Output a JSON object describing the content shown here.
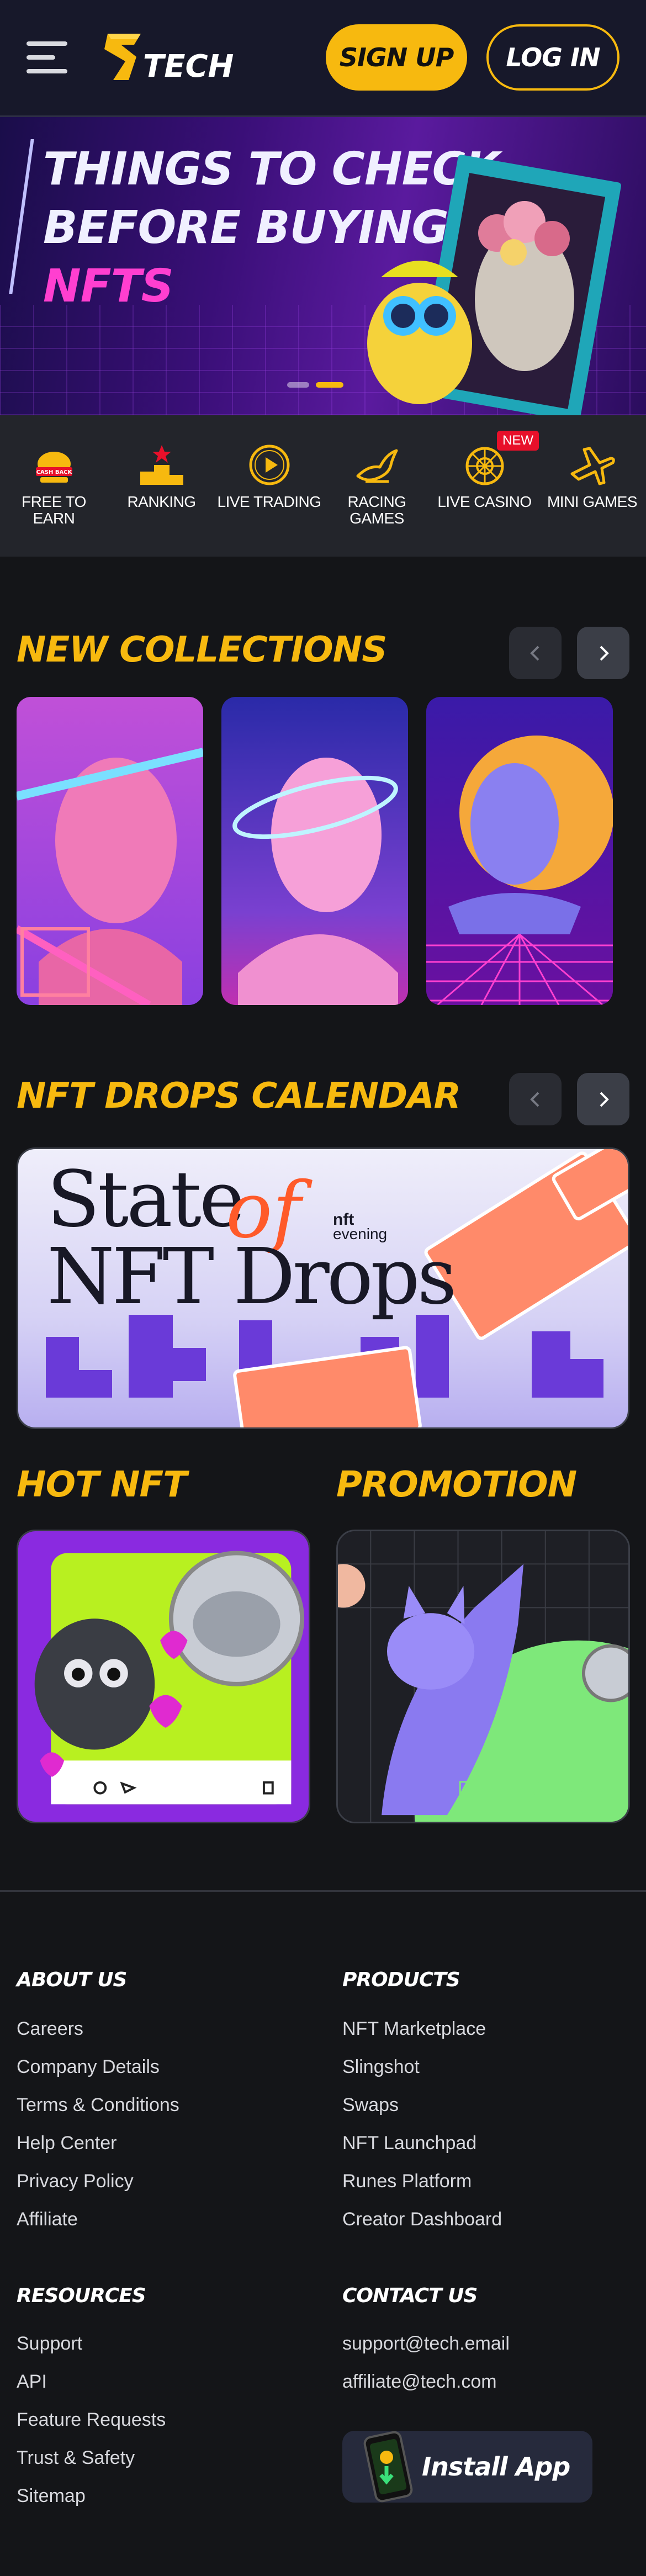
{
  "header": {
    "logo_text": "TECH",
    "signup_label": "SIGN UP",
    "login_label": "LOG IN"
  },
  "hero": {
    "line1": "THINGS TO CHECK",
    "line2": "BEFORE BUYING",
    "line3": "NFTS",
    "slides_total": 2,
    "active_slide": 2
  },
  "categories": [
    {
      "icon": "cash-back-icon",
      "label_1": "FREE TO",
      "label_2": "EARN",
      "badge": "CASH BACK"
    },
    {
      "icon": "ranking-podium-icon",
      "label_1": "RANKING",
      "label_2": ""
    },
    {
      "icon": "play-circle-icon",
      "label_1": "LIVE TRADING",
      "label_2": ""
    },
    {
      "icon": "racing-horse-icon",
      "label_1": "RACING",
      "label_2": "GAMES"
    },
    {
      "icon": "roulette-icon",
      "label_1": "LIVE CASINO",
      "label_2": "",
      "new_badge": "NEW"
    },
    {
      "icon": "airplane-icon",
      "label_1": "MINI GAMES",
      "label_2": ""
    }
  ],
  "collections": {
    "title": "NEW COLLECTIONS"
  },
  "drops": {
    "title": "NFT DROPS CALENDAR",
    "banner_state": "State",
    "banner_of": "of",
    "banner_nft": "NFT Drops",
    "banner_brand_1": "nft",
    "banner_brand_2": "evening"
  },
  "hot_nft": {
    "title": "HOT NFT"
  },
  "promotion": {
    "title": "PROMOTION",
    "art_text": "MEMEC"
  },
  "footer": {
    "about_title": "ABOUT US",
    "about_links": [
      "Careers",
      "Company Details",
      "Terms & Conditions",
      "Help Center",
      "Privacy Policy",
      "Affiliate"
    ],
    "products_title": "PRODUCTS",
    "products_links": [
      "NFT Marketplace",
      "Slingshot",
      "Swaps",
      "NFT Launchpad",
      "Runes Platform",
      "Creator Dashboard"
    ],
    "resources_title": "RESOURCES",
    "resources_links": [
      "Support",
      "API",
      "Feature Requests",
      "Trust & Safety",
      "Sitemap"
    ],
    "contact_title": "CONTACT US",
    "contact_links": [
      "support@tech.email",
      "affiliate@tech.com"
    ],
    "install_label": "Install App"
  },
  "colors": {
    "accent": "#f7b90f",
    "background": "#141518",
    "header": "#17182a",
    "category_bar": "#23252b",
    "hero_pink": "#ff3fd0",
    "new_badge": "#e8102a"
  }
}
